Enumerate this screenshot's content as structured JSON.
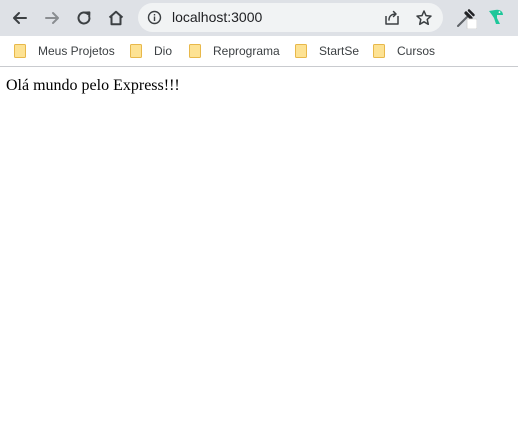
{
  "browser": {
    "address_bar": {
      "url": "localhost:3000"
    },
    "nav_icons": [
      "back-arrow-icon",
      "forward-arrow-icon",
      "reload-icon",
      "home-icon"
    ],
    "omnibox_icons": [
      "info-icon",
      "share-icon",
      "star-icon"
    ],
    "extension_icons": [
      "eyedropper-icon",
      "bird-extension-icon"
    ],
    "colors": {
      "toolbar_bg": "#dee1e6",
      "omnibox_bg": "#f1f3f4",
      "folder_fill": "#fde293",
      "folder_stroke": "#e8b84a",
      "extension_accent": "#1ec79a"
    }
  },
  "bookmarks": [
    {
      "label": "Meus Projetos",
      "icon": "folder-icon"
    },
    {
      "label": "Dio",
      "icon": "folder-icon"
    },
    {
      "label": "Reprograma",
      "icon": "folder-icon"
    },
    {
      "label": "StartSe",
      "icon": "folder-icon"
    },
    {
      "label": "Cursos",
      "icon": "folder-icon"
    }
  ],
  "page": {
    "body_text": "Olá mundo pelo Express!!!"
  }
}
